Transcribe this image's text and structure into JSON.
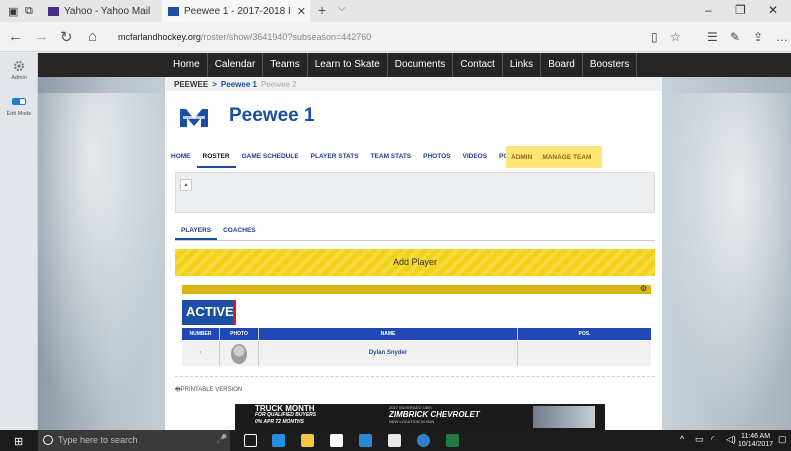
{
  "browser": {
    "tabs": [
      {
        "title": "Yahoo - Yahoo Mail"
      },
      {
        "title": "Peewee 1 - 2017-2018 I"
      }
    ],
    "url_host": "mcfarlandhockey.org",
    "url_path": "/roster/show/3641940?subseason=442760"
  },
  "app_rail": [
    {
      "label": "Admin",
      "icon": "gear-icon"
    },
    {
      "label": "Edit Mode",
      "icon": "toggle-icon"
    }
  ],
  "site_nav": [
    "Home",
    "Calendar",
    "Teams",
    "Learn to Skate",
    "Documents",
    "Contact",
    "Links",
    "Board",
    "Boosters"
  ],
  "breadcrumb": {
    "root": "PEEWEE",
    "sep": ">",
    "current": "Peewee 1",
    "other": "Peewee 2"
  },
  "team": {
    "title": "Peewee 1"
  },
  "team_nav": [
    "HOME",
    "ROSTER",
    "GAME SCHEDULE",
    "PLAYER STATS",
    "TEAM STATS",
    "PHOTOS",
    "VIDEOS",
    "POSTS"
  ],
  "admin_nav": [
    "ADMIN",
    "MANAGE TEAM"
  ],
  "sub_tabs": [
    "PLAYERS",
    "COACHES"
  ],
  "add_player_label": "Add Player",
  "active_label": "ACTIVE",
  "roster": {
    "columns": [
      "NUMBER",
      "PHOTO",
      "NAME",
      "POS."
    ],
    "rows": [
      {
        "number": "",
        "name": "Dylan Snyder",
        "pos": ""
      }
    ]
  },
  "printable_label": "PRINTABLE VERSION",
  "ad": {
    "line1": "TRUCK MONTH",
    "line2": "FOR QUALIFIED BUYERS",
    "line3": "0% APR 72 MONTHS",
    "tag": "2017 SILVERADO 1500",
    "brand": "ZIMBRICK CHEVROLET",
    "note": "NEW LOCATION IN SUN"
  },
  "taskbar": {
    "search_placeholder": "Type here to search",
    "time": "11:46 AM",
    "date": "10/14/2017"
  },
  "colors": {
    "brand_blue": "#1b4fa1",
    "accent_yellow": "#f4d219",
    "accent_red": "#d21f26"
  }
}
